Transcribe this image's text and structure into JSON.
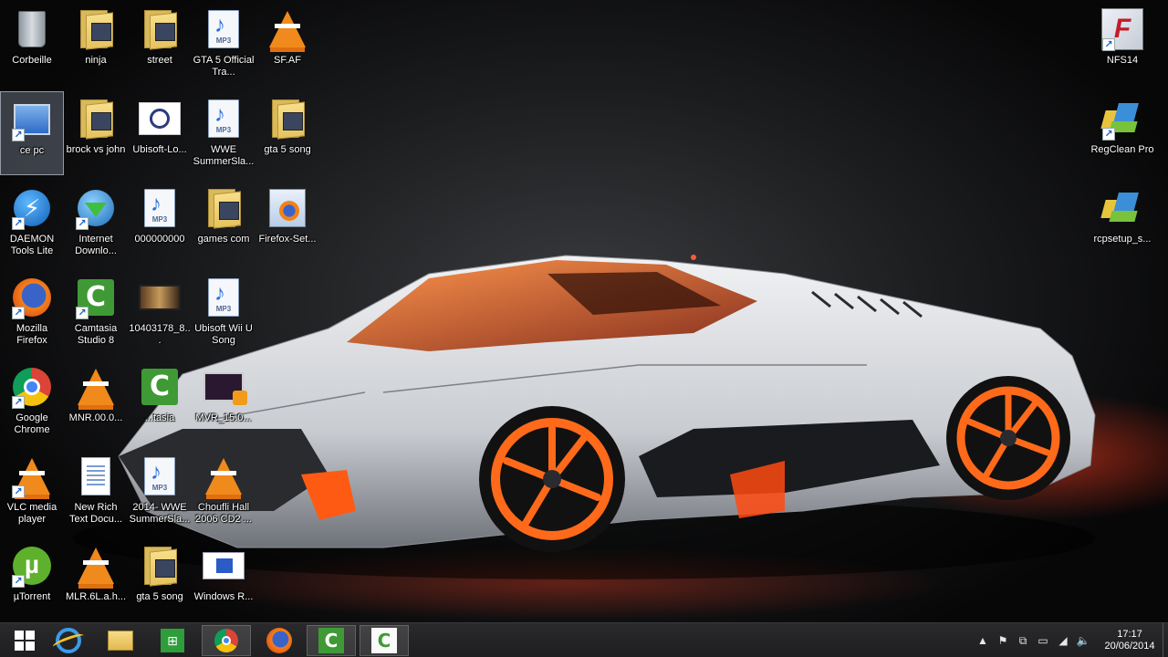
{
  "desktop": {
    "icons": [
      {
        "label": "Corbeille",
        "icon": "recycle-bin-icon"
      },
      {
        "label": "ninja",
        "icon": "folder-icon"
      },
      {
        "label": "street",
        "icon": "folder-icon"
      },
      {
        "label": "GTA 5 Official Tra...",
        "icon": "mp3-file-icon"
      },
      {
        "label": "SF.AF",
        "icon": "vlc-icon"
      },
      {
        "label": "ce pc",
        "icon": "computer-icon"
      },
      {
        "label": "brock vs john",
        "icon": "folder-icon"
      },
      {
        "label": "Ubisoft-Lo...",
        "icon": "ubisoft-icon"
      },
      {
        "label": "WWE SummerSla...",
        "icon": "mp3-file-icon"
      },
      {
        "label": "gta 5 song",
        "icon": "folder-icon"
      },
      {
        "label": "DAEMON Tools Lite",
        "icon": "daemon-tools-icon"
      },
      {
        "label": "Internet Downlo...",
        "icon": "internet-download-manager-icon"
      },
      {
        "label": "000000000",
        "icon": "mp3-file-icon"
      },
      {
        "label": "games com",
        "icon": "folder-icon"
      },
      {
        "label": "Firefox-Set...",
        "icon": "firefox-setup-icon"
      },
      {
        "label": "Mozilla Firefox",
        "icon": "firefox-icon"
      },
      {
        "label": "Camtasia Studio 8",
        "icon": "camtasia-icon"
      },
      {
        "label": "10403178_8...",
        "icon": "video-thumbnail-icon"
      },
      {
        "label": "Ubisoft Wii U Song",
        "icon": "mp3-file-icon"
      },
      {
        "label": "Google Chrome",
        "icon": "chrome-icon"
      },
      {
        "label": "MNR.00.0...",
        "icon": "vlc-icon"
      },
      {
        "label": "...tasia",
        "icon": "camtasia-icon"
      },
      {
        "label": "MVR_15.0...",
        "icon": "mkv-video-icon"
      },
      {
        "label": "VLC media player",
        "icon": "vlc-icon"
      },
      {
        "label": "New Rich Text Docu...",
        "icon": "document-icon"
      },
      {
        "label": "2014- WWE SummerSla...",
        "icon": "mp3-file-icon"
      },
      {
        "label": "Choufli Hall 2006 CD2 ...",
        "icon": "vlc-icon"
      },
      {
        "label": "µTorrent",
        "icon": "utorrent-icon"
      },
      {
        "label": "MLR.6L.a.h...",
        "icon": "vlc-icon"
      },
      {
        "label": "gta 5 song",
        "icon": "folder-icon"
      },
      {
        "label": "Windows R...",
        "icon": "windows-media-icon"
      },
      {
        "label": "NFS14",
        "icon": "nfs-icon"
      },
      {
        "label": "RegClean Pro",
        "icon": "regclean-icon"
      },
      {
        "label": "rcpsetup_s...",
        "icon": "regclean-setup-icon"
      }
    ],
    "mp3_tag": "MP3",
    "shortcut_glyph": "↗"
  },
  "taskbar": {
    "buttons": [
      {
        "name": "start-button",
        "icon": "windows-logo-icon"
      },
      {
        "name": "internet-explorer-button",
        "icon": "internet-explorer-icon"
      },
      {
        "name": "file-explorer-button",
        "icon": "folder-icon"
      },
      {
        "name": "store-button",
        "icon": "store-icon"
      },
      {
        "name": "chrome-button",
        "icon": "chrome-icon"
      },
      {
        "name": "firefox-button",
        "icon": "firefox-icon"
      },
      {
        "name": "camtasia-button",
        "icon": "camtasia-icon"
      },
      {
        "name": "camtasia-recorder-button",
        "icon": "camtasia-recorder-icon"
      }
    ],
    "store_glyph": "⊞",
    "camtasia_glyph": "C",
    "tray": {
      "icons": [
        "chevron-up-icon",
        "flag-icon",
        "network-icon",
        "battery-icon",
        "signal-icon",
        "volume-icon"
      ],
      "glyphs": [
        "▲",
        "⚑",
        "⧉",
        "▭",
        "◢",
        "🔈"
      ],
      "time": "17:17",
      "date": "20/06/2014"
    }
  },
  "colors": {
    "car_body": "#d9dbde",
    "wheel_accent": "#ff6a1a",
    "taskbar": "#202022"
  }
}
